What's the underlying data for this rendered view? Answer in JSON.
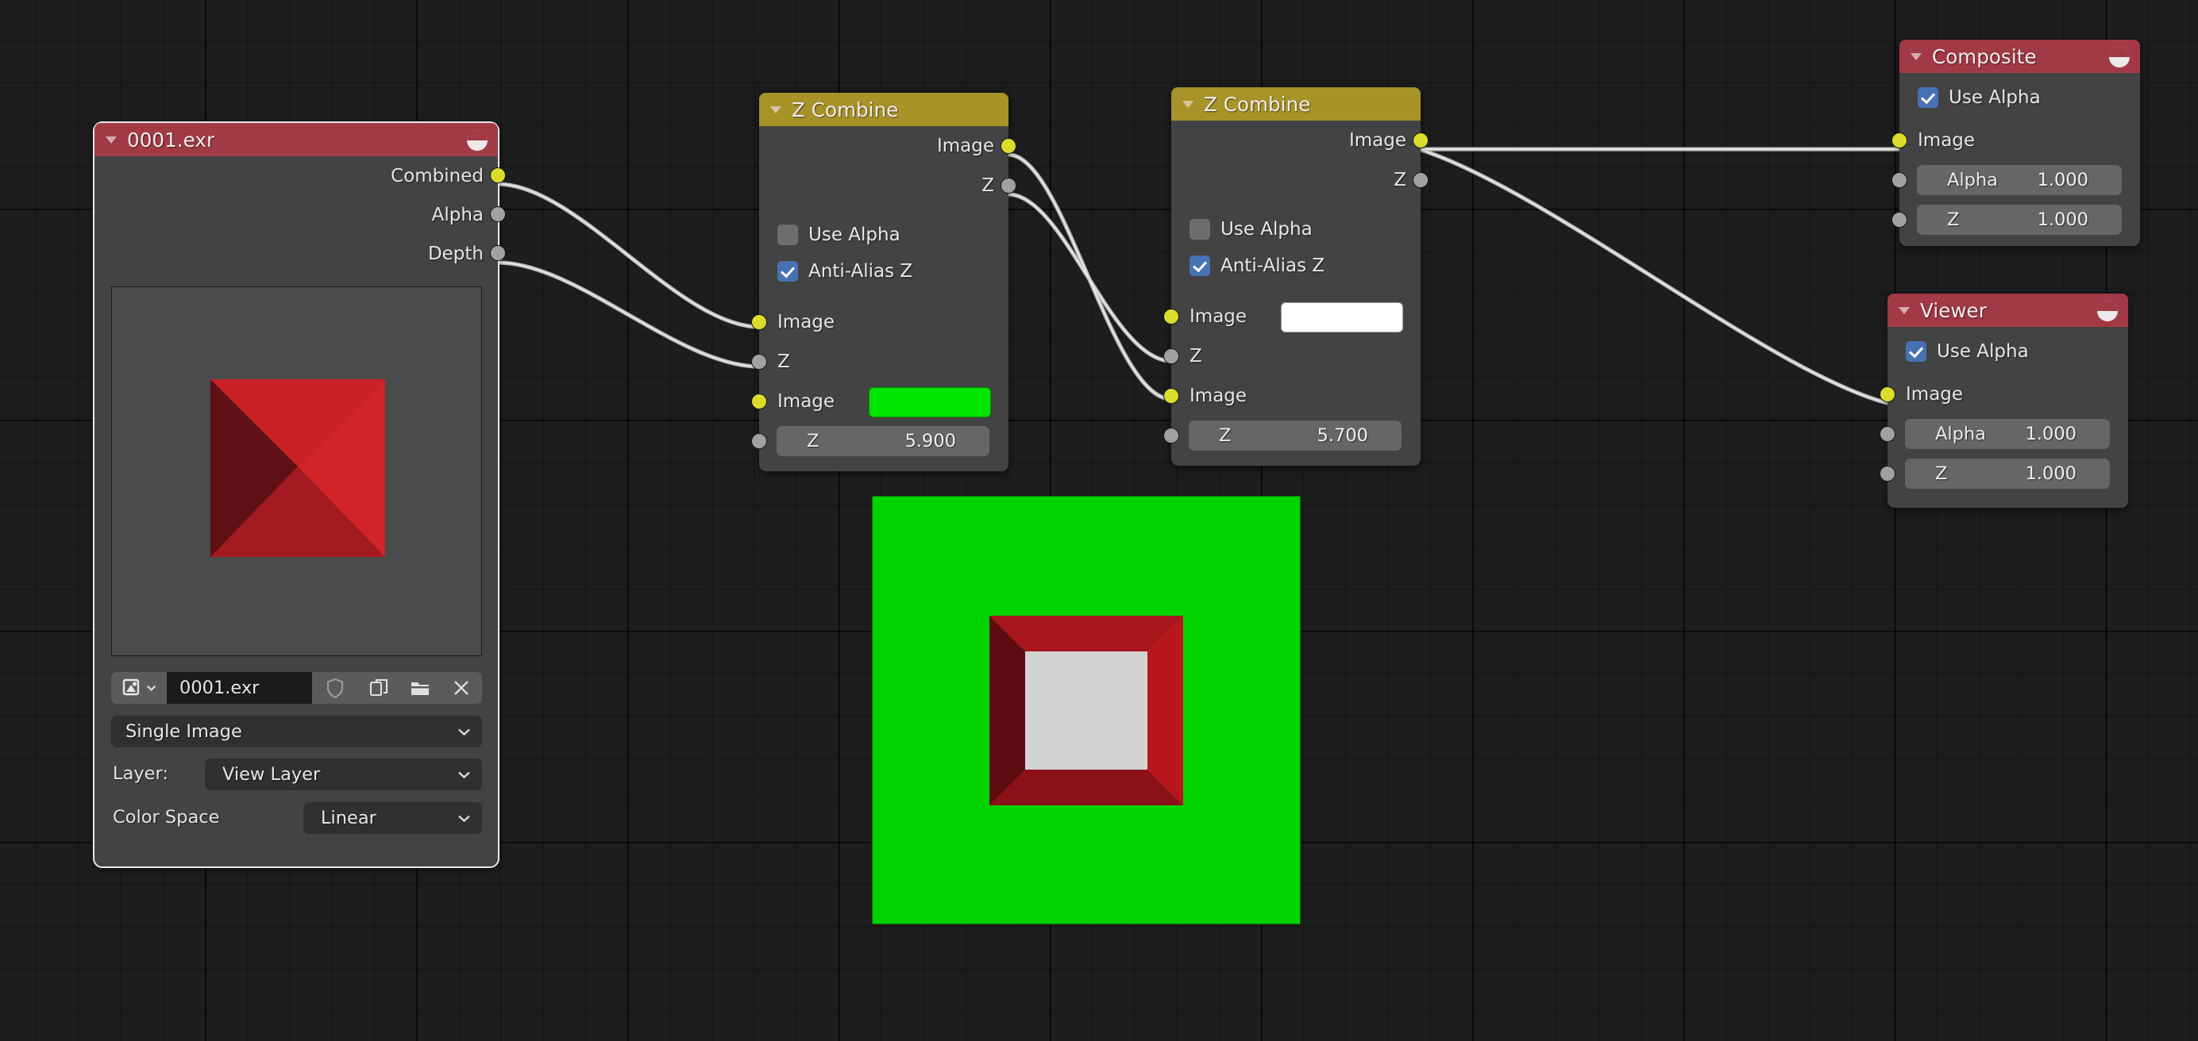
{
  "editor": {
    "name": "blender-compositor-node-editor",
    "background_color": "#1d1d1d"
  },
  "backdrop": {
    "name": "compositor-backdrop-preview",
    "background_color": "#00d400",
    "frame_color": "#b01018",
    "center_color": "#d4d4d4"
  },
  "nodes": {
    "image_node": {
      "title": "0001.exr",
      "header_color": "#a23a46",
      "selected": true,
      "icon": "image-datablock-icon",
      "outputs": [
        {
          "label": "Combined",
          "type": "image",
          "connected": true
        },
        {
          "label": "Alpha",
          "type": "value",
          "connected": false
        },
        {
          "label": "Depth",
          "type": "value",
          "connected": true
        }
      ],
      "datablock": {
        "browse_icon": "image-browse-icon",
        "name_value": "0001.exr",
        "fake_user_icon": "shield-icon",
        "new_copy_icon": "duplicate-icon",
        "open_icon": "folder-icon",
        "unlink_icon": "close-x-icon"
      },
      "source": {
        "value": "Single Image"
      },
      "layer": {
        "label": "Layer:",
        "value": "View Layer"
      },
      "color_space": {
        "label": "Color Space",
        "value": "Linear"
      }
    },
    "zcombine_1": {
      "title": "Z Combine",
      "header_color": "#a79327",
      "outputs": [
        {
          "label": "Image",
          "type": "image",
          "connected": true
        },
        {
          "label": "Z",
          "type": "value",
          "connected": true
        }
      ],
      "options": [
        {
          "label": "Use Alpha",
          "checked": false
        },
        {
          "label": "Anti-Alias Z",
          "checked": true
        }
      ],
      "inputs": [
        {
          "label": "Image",
          "type": "image",
          "connected": true,
          "widget": "none"
        },
        {
          "label": "Z",
          "type": "value",
          "connected": true,
          "widget": "none"
        },
        {
          "label": "Image",
          "type": "image",
          "connected": false,
          "widget": "color",
          "color": "#00e500"
        },
        {
          "label": "Z",
          "type": "value",
          "connected": false,
          "widget": "number",
          "value": "5.900"
        }
      ]
    },
    "zcombine_2": {
      "title": "Z Combine",
      "header_color": "#a79327",
      "outputs": [
        {
          "label": "Image",
          "type": "image",
          "connected": true
        },
        {
          "label": "Z",
          "type": "value",
          "connected": false
        }
      ],
      "options": [
        {
          "label": "Use Alpha",
          "checked": false
        },
        {
          "label": "Anti-Alias Z",
          "checked": true
        }
      ],
      "inputs": [
        {
          "label": "Image",
          "type": "image",
          "connected": false,
          "widget": "color",
          "color": "#ffffff"
        },
        {
          "label": "Z",
          "type": "value",
          "connected": true,
          "widget": "none"
        },
        {
          "label": "Image",
          "type": "image",
          "connected": true,
          "widget": "none"
        },
        {
          "label": "Z",
          "type": "value",
          "connected": false,
          "widget": "number",
          "value": "5.700"
        }
      ]
    },
    "composite": {
      "title": "Composite",
      "header_color": "#a23a46",
      "icon": "render-output-icon",
      "options": [
        {
          "label": "Use Alpha",
          "checked": true
        }
      ],
      "inputs": [
        {
          "label": "Image",
          "type": "image",
          "connected": true,
          "widget": "none"
        },
        {
          "label": "Alpha",
          "type": "value",
          "connected": false,
          "widget": "number",
          "value": "1.000"
        },
        {
          "label": "Z",
          "type": "value",
          "connected": false,
          "widget": "number",
          "value": "1.000"
        }
      ]
    },
    "viewer": {
      "title": "Viewer",
      "header_color": "#a23a46",
      "icon": "render-output-icon",
      "options": [
        {
          "label": "Use Alpha",
          "checked": true
        }
      ],
      "inputs": [
        {
          "label": "Image",
          "type": "image",
          "connected": true,
          "widget": "none"
        },
        {
          "label": "Alpha",
          "type": "value",
          "connected": false,
          "widget": "number",
          "value": "1.000"
        },
        {
          "label": "Z",
          "type": "value",
          "connected": false,
          "widget": "number",
          "value": "1.000"
        }
      ]
    }
  },
  "links": [
    {
      "from": "image_node.Combined",
      "to": "zcombine_1.Image_1"
    },
    {
      "from": "image_node.Depth",
      "to": "zcombine_1.Z_1"
    },
    {
      "from": "zcombine_1.Image",
      "to": "zcombine_2.Image_2"
    },
    {
      "from": "zcombine_1.Z",
      "to": "zcombine_2.Z_1"
    },
    {
      "from": "zcombine_2.Image",
      "to": "composite.Image"
    },
    {
      "from": "zcombine_2.Image",
      "to": "viewer.Image"
    }
  ]
}
